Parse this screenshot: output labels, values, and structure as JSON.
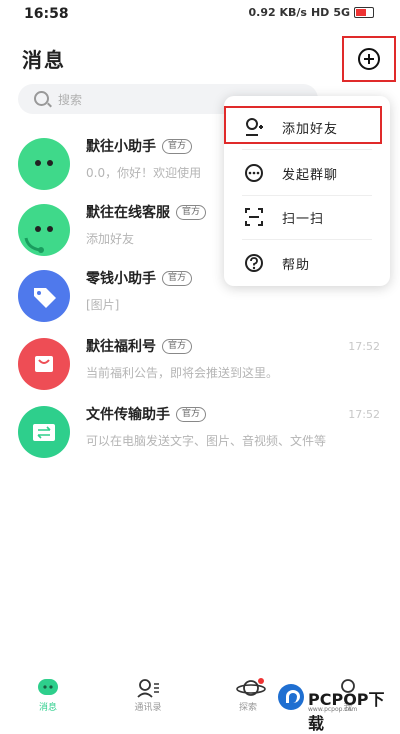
{
  "status": {
    "time": "16:58",
    "network": "0.92 KB/s",
    "hd": "HD",
    "signal": "5G"
  },
  "header": {
    "title": "消息"
  },
  "search": {
    "placeholder": "搜索"
  },
  "conversations": [
    {
      "name": "默往小助手",
      "tag": "官方",
      "preview": "0.0，你好！欢迎使用",
      "time": "",
      "avatar_color": "#3fd98a",
      "avatar_icon": "chat-face-icon"
    },
    {
      "name": "默往在线客服",
      "tag": "官方",
      "preview": "添加好友",
      "time": "",
      "avatar_color": "#3fd98a",
      "avatar_icon": "headset-face-icon"
    },
    {
      "name": "零钱小助手",
      "tag": "官方",
      "preview": "[图片]",
      "time": "",
      "avatar_color": "#4f79ec",
      "avatar_icon": "price-tag-icon"
    },
    {
      "name": "默往福利号",
      "tag": "官方",
      "preview": "当前福利公告，即将会推送到这里。",
      "time": "17:52",
      "avatar_color": "#ee4d55",
      "avatar_icon": "shopping-bag-icon"
    },
    {
      "name": "文件传输助手",
      "tag": "官方",
      "preview": "可以在电脑发送文字、图片、音视频、文件等",
      "time": "17:52",
      "avatar_color": "#2ecf8c",
      "avatar_icon": "transfer-icon"
    }
  ],
  "menu": {
    "items": [
      {
        "label": "添加好友",
        "icon": "add-user-icon"
      },
      {
        "label": "发起群聊",
        "icon": "group-chat-icon"
      },
      {
        "label": "扫一扫",
        "icon": "scan-icon"
      },
      {
        "label": "帮助",
        "icon": "help-icon"
      }
    ]
  },
  "tabs": [
    {
      "label": "消息",
      "icon": "chat-bubble-icon",
      "active": true
    },
    {
      "label": "通讯录",
      "icon": "contacts-icon",
      "active": false
    },
    {
      "label": "探索",
      "icon": "planet-icon",
      "active": false
    },
    {
      "label": "我",
      "icon": "profile-icon",
      "active": false
    }
  ],
  "watermark": {
    "brand": "PCPOP下载",
    "sub": "www.pcpop.com"
  },
  "colors": {
    "accent": "#2ecf8c",
    "highlight_box": "#e02a2a"
  }
}
